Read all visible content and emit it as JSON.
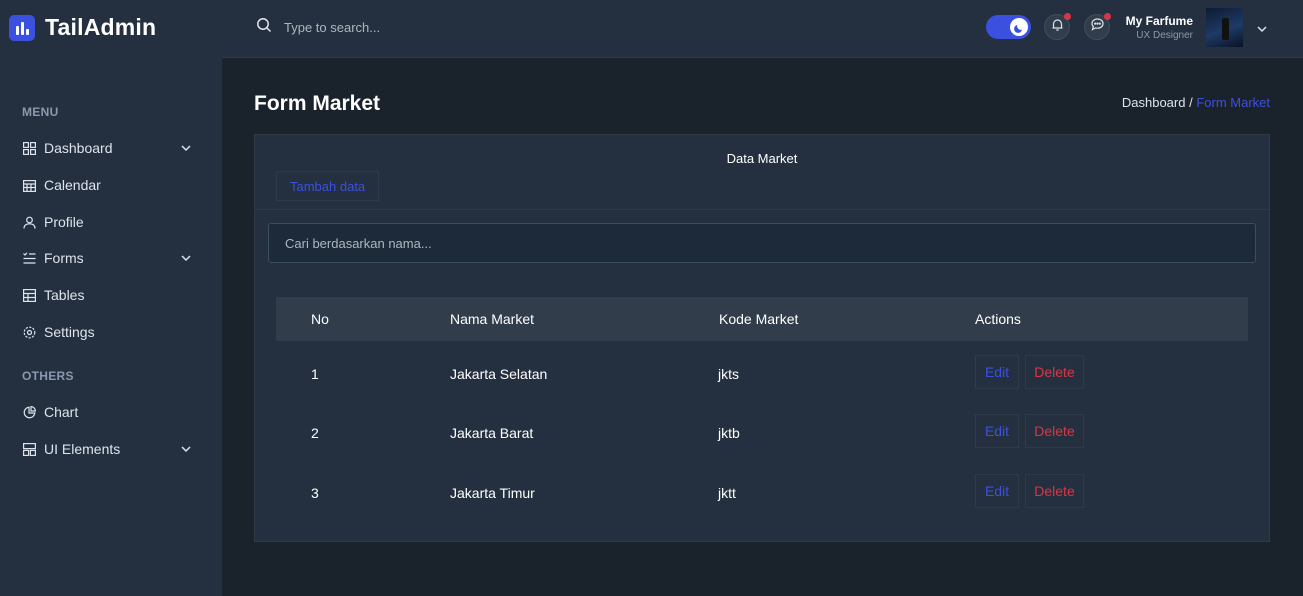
{
  "app": {
    "name": "TailAdmin"
  },
  "sidebar": {
    "menu_label": "MENU",
    "others_label": "OTHERS",
    "items": [
      {
        "label": "Dashboard",
        "icon": "grid-icon",
        "has_submenu": true
      },
      {
        "label": "Calendar",
        "icon": "calendar-icon",
        "has_submenu": false
      },
      {
        "label": "Profile",
        "icon": "user-icon",
        "has_submenu": false
      },
      {
        "label": "Forms",
        "icon": "list-icon",
        "has_submenu": true
      },
      {
        "label": "Tables",
        "icon": "table-icon",
        "has_submenu": false
      },
      {
        "label": "Settings",
        "icon": "gear-icon",
        "has_submenu": false
      }
    ],
    "other_items": [
      {
        "label": "Chart",
        "icon": "pie-chart-icon",
        "has_submenu": false
      },
      {
        "label": "UI Elements",
        "icon": "layers-icon",
        "has_submenu": true
      }
    ]
  },
  "header": {
    "search_placeholder": "Type to search...",
    "dark_mode": true,
    "user": {
      "name": "My Farfume",
      "role": "UX Designer"
    }
  },
  "page": {
    "title": "Form Market",
    "breadcrumb": {
      "parent": "Dashboard /",
      "current": "Form Market"
    }
  },
  "card": {
    "title": "Data Market",
    "add_label": "Tambah data",
    "filter_placeholder": "Cari berdasarkan nama..."
  },
  "table": {
    "columns": [
      "No",
      "Nama Market",
      "Kode Market",
      "Actions"
    ],
    "rows": [
      {
        "no": "1",
        "nama": "Jakarta Selatan",
        "kode": "jkts"
      },
      {
        "no": "2",
        "nama": "Jakarta Barat",
        "kode": "jktb"
      },
      {
        "no": "3",
        "nama": "Jakarta Timur",
        "kode": "jktt"
      }
    ],
    "edit_label": "Edit",
    "delete_label": "Delete"
  },
  "colors": {
    "primary": "#3c50e0",
    "danger": "#dc3545",
    "background": "#1a222c",
    "panel": "#24303f"
  }
}
